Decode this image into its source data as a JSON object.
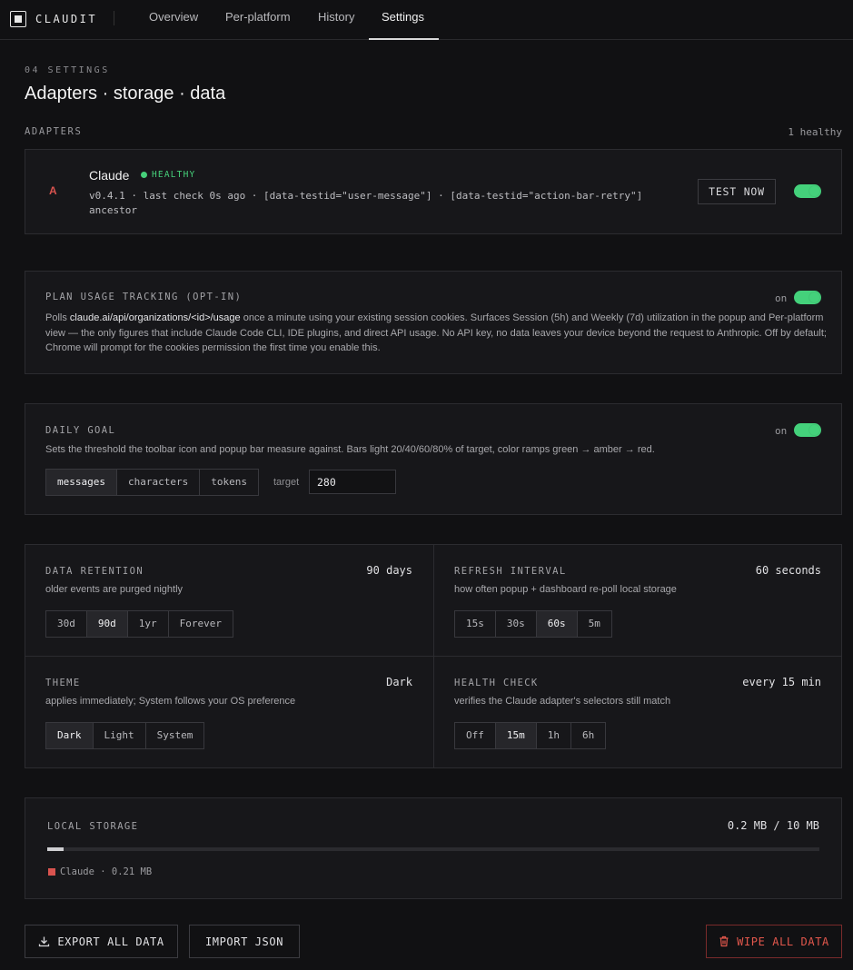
{
  "app": {
    "name": "CLAUDIT"
  },
  "nav": {
    "tabs": [
      {
        "label": "Overview",
        "active": false
      },
      {
        "label": "Per-platform",
        "active": false
      },
      {
        "label": "History",
        "active": false
      },
      {
        "label": "Settings",
        "active": true
      }
    ]
  },
  "header": {
    "eyebrow": "04 SETTINGS",
    "title": "Adapters · storage · data"
  },
  "adapters": {
    "label": "ADAPTERS",
    "summary": "1 healthy",
    "items": [
      {
        "letter": "A",
        "name": "Claude",
        "status": "HEALTHY",
        "meta": "v0.4.1 · last check 0s ago · [data-testid=\"user-message\"] · [data-testid=\"action-bar-retry\"] ancestor",
        "test_label": "TEST NOW",
        "enabled": true
      }
    ]
  },
  "plan_usage": {
    "title": "PLAN USAGE TRACKING (OPT-IN)",
    "toggle_label": "on",
    "desc_prefix": "Polls ",
    "desc_endpoint": "claude.ai/api/organizations/<id>/usage",
    "desc_suffix": " once a minute using your existing session cookies. Surfaces Session (5h) and Weekly (7d) utilization in the popup and Per-platform view — the only figures that include Claude Code CLI, IDE plugins, and direct API usage. No API key, no data leaves your device beyond the request to Anthropic. Off by default; Chrome will prompt for the cookies permission the first time you enable this."
  },
  "daily_goal": {
    "title": "DAILY GOAL",
    "toggle_label": "on",
    "desc": "Sets the threshold the toolbar icon and popup bar measure against. Bars light 20/40/60/80% of target, color ramps green → amber → red.",
    "options": [
      "messages",
      "characters",
      "tokens"
    ],
    "selected": "messages",
    "target_label": "target",
    "target_value": "280"
  },
  "settings_grid": {
    "retention": {
      "title": "DATA RETENTION",
      "value": "90 days",
      "desc": "older events are purged nightly",
      "options": [
        "30d",
        "90d",
        "1yr",
        "Forever"
      ],
      "selected": "90d"
    },
    "refresh": {
      "title": "REFRESH INTERVAL",
      "value": "60 seconds",
      "desc": "how often popup + dashboard re-poll local storage",
      "options": [
        "15s",
        "30s",
        "60s",
        "5m"
      ],
      "selected": "60s"
    },
    "theme": {
      "title": "THEME",
      "value": "Dark",
      "desc": "applies immediately; System follows your OS preference",
      "options": [
        "Dark",
        "Light",
        "System"
      ],
      "selected": "Dark"
    },
    "health": {
      "title": "HEALTH CHECK",
      "value": "every 15 min",
      "desc": "verifies the Claude adapter's selectors still match",
      "options": [
        "Off",
        "15m",
        "1h",
        "6h"
      ],
      "selected": "15m"
    }
  },
  "storage": {
    "title": "LOCAL STORAGE",
    "usage": "0.2 MB / 10 MB",
    "fill_fraction": 0.021,
    "legend": "Claude · 0.21 MB",
    "legend_color": "#d9534f"
  },
  "actions": {
    "export": "EXPORT ALL DATA",
    "import": "IMPORT JSON",
    "wipe": "WIPE ALL DATA"
  },
  "colors": {
    "accent_green": "#44d17b",
    "danger": "#e2574c",
    "background": "#111113"
  }
}
